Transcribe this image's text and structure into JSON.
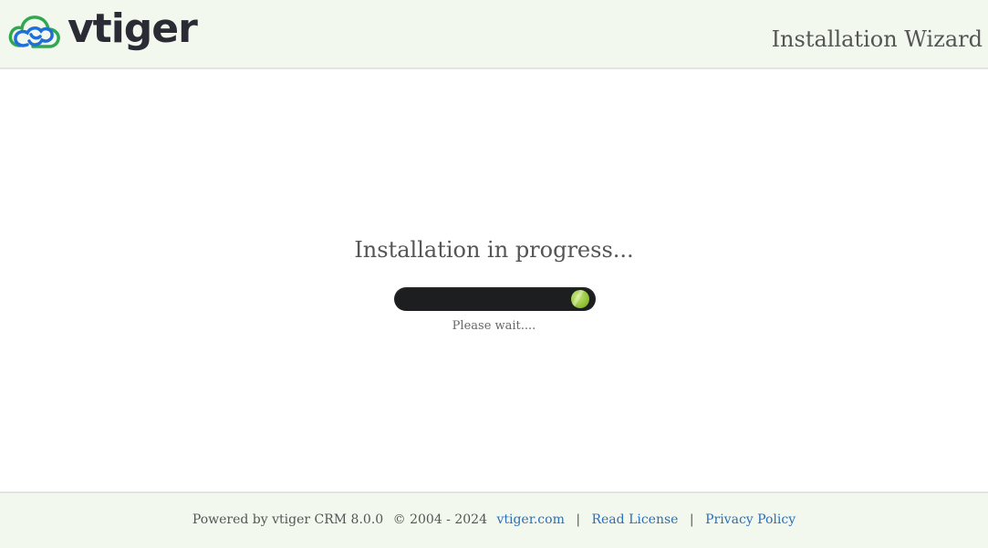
{
  "header": {
    "logo_text": "vtiger",
    "logo_icon": "cloud-logo-icon",
    "title": "Installation Wizard"
  },
  "main": {
    "heading": "Installation in progress...",
    "progress_percent": 100,
    "wait_text": "Please wait...."
  },
  "footer": {
    "powered_by": "Powered by vtiger CRM 8.0.0",
    "copyright": "© 2004 - 2024",
    "links": {
      "site": "vtiger.com",
      "license": "Read License",
      "privacy": "Privacy Policy"
    },
    "separator": "|"
  },
  "colors": {
    "header_bg": "#f3f8ef",
    "link": "#2a6fb7",
    "progress_track": "#1d1e20",
    "progress_knob": "#94c43a",
    "logo_blue": "#1f6fd8",
    "logo_green": "#2fa84f"
  }
}
